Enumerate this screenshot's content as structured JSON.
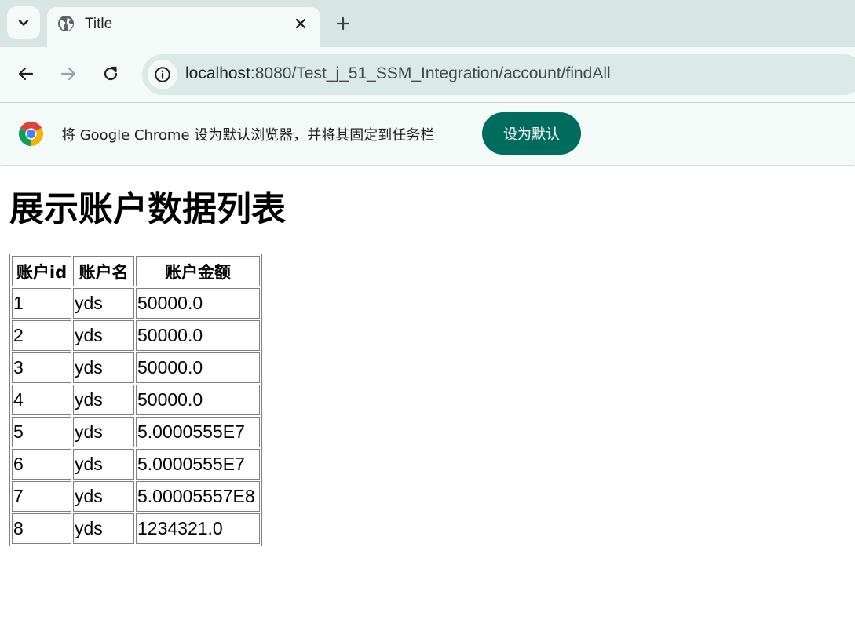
{
  "browser": {
    "tab": {
      "title": "Title",
      "favicon": "globe-icon",
      "close_icon": "close-icon"
    },
    "tab_menu_icon": "chevron-down-icon",
    "new_tab_icon": "plus-icon",
    "nav": {
      "back_icon": "arrow-left-icon",
      "forward_icon": "arrow-right-icon",
      "reload_icon": "reload-icon"
    },
    "address_bar": {
      "site_info_icon": "info-icon",
      "host": "localhost",
      "path": ":8080/Test_j_51_SSM_Integration/account/findAll"
    },
    "infobar": {
      "logo": "chrome-logo-icon",
      "message": "将 Google Chrome 设为默认浏览器，并将其固定到任务栏",
      "button_label": "设为默认",
      "button_color": "#006b5f"
    }
  },
  "page": {
    "title": "展示账户数据列表",
    "table": {
      "headers": [
        "账户id",
        "账户名",
        "账户金额"
      ],
      "rows": [
        [
          "1",
          "yds",
          "50000.0"
        ],
        [
          "2",
          "yds",
          "50000.0"
        ],
        [
          "3",
          "yds",
          "50000.0"
        ],
        [
          "4",
          "yds",
          "50000.0"
        ],
        [
          "5",
          "yds",
          "5.0000555E7"
        ],
        [
          "6",
          "yds",
          "5.0000555E7"
        ],
        [
          "7",
          "yds",
          "5.00005557E8"
        ],
        [
          "8",
          "yds",
          "1234321.0"
        ]
      ]
    }
  },
  "colors": {
    "tabstrip_bg": "#d7e6e2",
    "toolbar_bg": "#f4faf8",
    "omnibox_bg": "#daebe7",
    "accent": "#006b5f"
  }
}
